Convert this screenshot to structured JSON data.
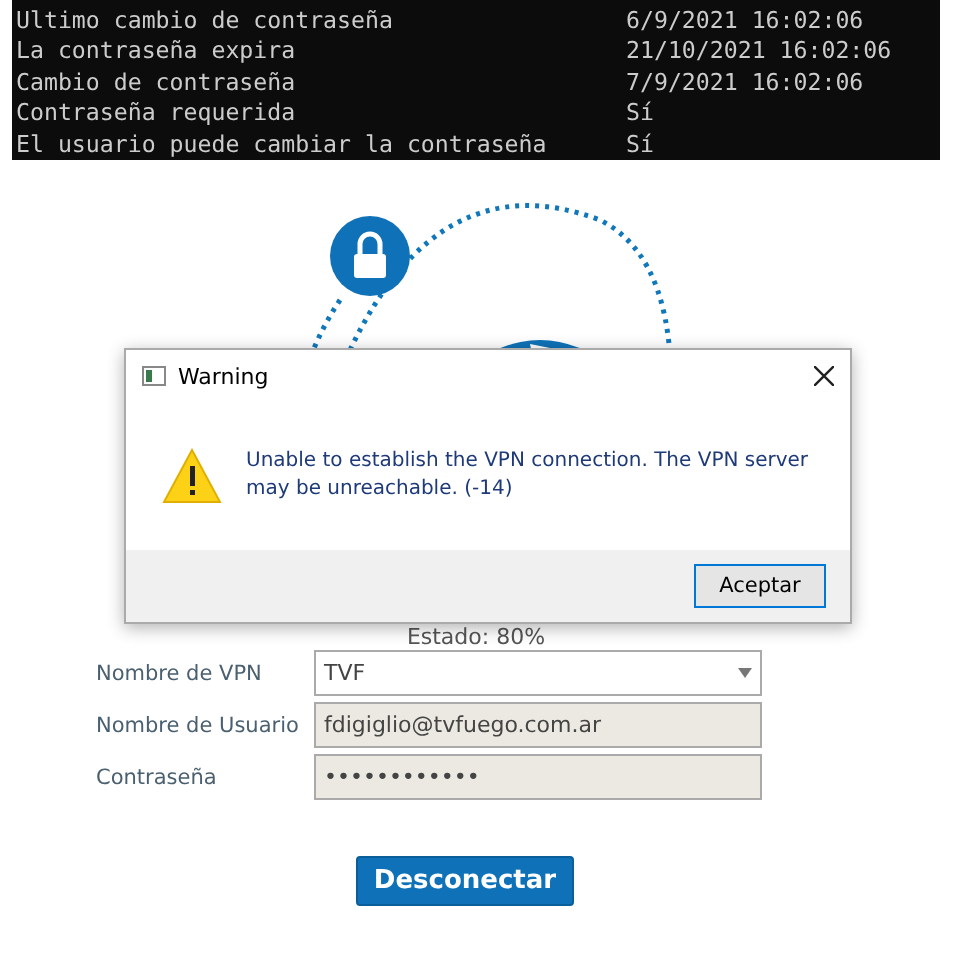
{
  "terminal": {
    "rows": [
      {
        "label": "Ultimo cambio de contraseña",
        "value": "6/9/2021 16:02:06"
      },
      {
        "label": "La contraseña expira",
        "value": "21/10/2021 16:02:06"
      },
      {
        "label": "Cambio de contraseña",
        "value": "7/9/2021 16:02:06"
      },
      {
        "label": "Contraseña requerida",
        "value": "Sí"
      },
      {
        "label": "El usuario puede cambiar la contraseña",
        "value": "Sí"
      }
    ]
  },
  "dialog": {
    "title": "Warning",
    "message": "Unable to establish the VPN connection. The VPN server may be unreachable. (-14)",
    "button": "Aceptar"
  },
  "status": "Estado: 80%",
  "fields": [
    {
      "kind": "select",
      "label": "Nombre de VPN",
      "value": "TVF"
    },
    {
      "kind": "text",
      "label": "Nombre de Usuario",
      "value": "fdigiglio@tvfuego.com.ar"
    },
    {
      "kind": "password",
      "label": "Contraseña",
      "value": "••••••••••••"
    }
  ],
  "button": "Desconectar"
}
